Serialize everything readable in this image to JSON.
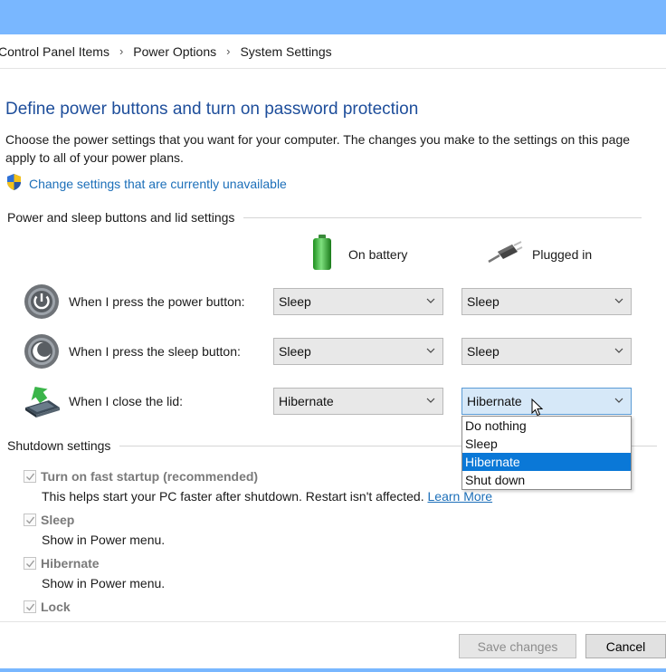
{
  "breadcrumb": {
    "items": [
      "Control Panel Items",
      "Power Options",
      "System Settings"
    ],
    "separator": "›"
  },
  "page": {
    "heading": "Define power buttons and turn on password protection",
    "description": "Choose the power settings that you want for your computer. The changes you make to the settings on this page apply to all of your power plans.",
    "change_link": "Change settings that are currently unavailable"
  },
  "power_section": {
    "title": "Power and sleep buttons and lid settings",
    "columns": {
      "battery": "On battery",
      "plugged": "Plugged in"
    },
    "rows": [
      {
        "label": "When I press the power button:",
        "battery": "Sleep",
        "plugged": "Sleep",
        "icon": "power-icon"
      },
      {
        "label": "When I press the sleep button:",
        "battery": "Sleep",
        "plugged": "Sleep",
        "icon": "sleep-icon"
      },
      {
        "label": "When I close the lid:",
        "battery": "Hibernate",
        "plugged": "Hibernate",
        "icon": "lid-icon"
      }
    ],
    "dropdown_options": [
      "Do nothing",
      "Sleep",
      "Hibernate",
      "Shut down"
    ],
    "dropdown_selected": "Hibernate"
  },
  "shutdown_section": {
    "title": "Shutdown settings",
    "items": [
      {
        "label": "Turn on fast startup (recommended)",
        "checked": true,
        "sub": "This helps start your PC faster after shutdown. Restart isn't affected.",
        "link": "Learn More"
      },
      {
        "label": "Sleep",
        "checked": true,
        "sub": "Show in Power menu."
      },
      {
        "label": "Hibernate",
        "checked": true,
        "sub": "Show in Power menu."
      },
      {
        "label": "Lock",
        "checked": true
      }
    ]
  },
  "footer": {
    "save_label": "Save changes",
    "cancel_label": "Cancel"
  },
  "colors": {
    "accent": "#1e4e9b",
    "link": "#1c6fb9",
    "titlebar": "#79b7ff",
    "selection": "#0a78d7"
  }
}
